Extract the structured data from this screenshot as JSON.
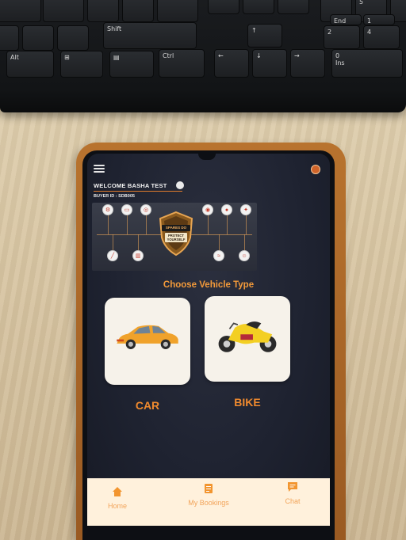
{
  "keyboard": {
    "keys": [
      "Shift",
      "Alt",
      "Ctrl",
      "End",
      "Ins",
      "0",
      "1",
      "2",
      "4",
      "5"
    ]
  },
  "app": {
    "welcome_text": "WELCOME BASHA TEST",
    "buyer_id": "BUYER ID : SDB005",
    "banner": {
      "brand": "SPARES DO",
      "tagline": "PROTECT YOURSELF"
    },
    "choose_title": "Choose Vehicle Type",
    "vehicles": [
      {
        "label": "CAR",
        "icon": "car-icon"
      },
      {
        "label": "BIKE",
        "icon": "bike-icon"
      }
    ],
    "nav": [
      {
        "label": "Home",
        "icon": "home-icon"
      },
      {
        "label": "My Bookings",
        "icon": "bookings-icon"
      },
      {
        "label": "Chat",
        "icon": "chat-icon"
      }
    ]
  },
  "colors": {
    "accent": "#f08a2e",
    "app_bg": "#1e2230",
    "nav_bg": "#fff1dc"
  }
}
